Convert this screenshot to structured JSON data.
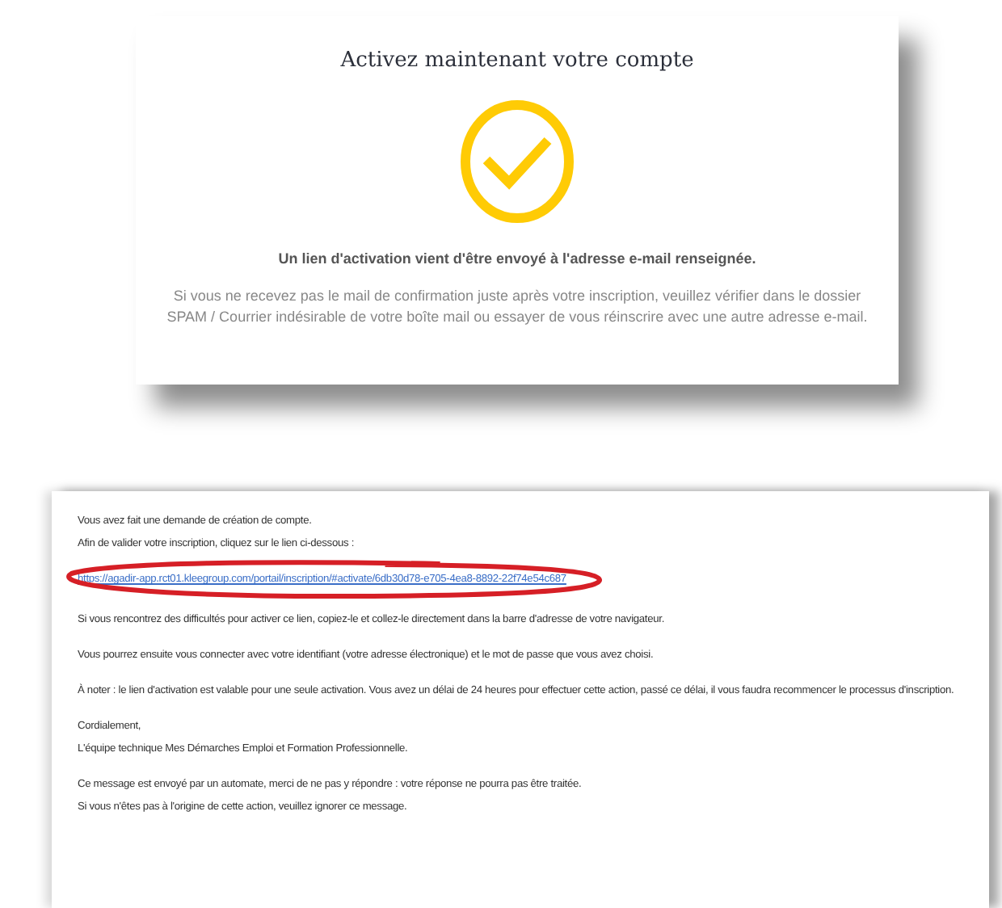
{
  "card": {
    "title": "Activez maintenant votre compte",
    "message": "Un lien d'activation vient d'être envoyé à l'adresse e-mail renseignée.",
    "note": "Si vous ne recevez pas le mail de confirmation juste après votre inscription, veuillez vérifier dans le dossier SPAM / Courrier indésirable de votre boîte mail ou essayer de vous réinscrire avec une autre adresse e-mail."
  },
  "email": {
    "blocks": [
      {
        "kind": "lines",
        "lines": [
          "Vous avez fait une demande de création de compte.",
          "Afin de valider votre inscription, cliquez sur le lien ci-dessous :"
        ]
      },
      {
        "kind": "link",
        "text": "https://agadir-app.rct01.kleegroup.com/portail/inscription/#activate/6db30d78-e705-4ea8-8892-22f74e54c687"
      },
      {
        "kind": "lines",
        "lines": [
          "Si vous rencontrez des difficultés pour activer ce lien, copiez-le et collez-le directement dans la barre d'adresse de votre navigateur."
        ]
      },
      {
        "kind": "lines",
        "lines": [
          "Vous pourrez ensuite vous connecter avec votre identifiant (votre adresse électronique) et le mot de passe que vous avez choisi."
        ]
      },
      {
        "kind": "lines",
        "lines": [
          "À noter : le lien d'activation est valable pour une seule activation. Vous avez un délai de 24 heures pour effectuer cette action, passé ce délai, il vous faudra recommencer le processus d'inscription."
        ]
      },
      {
        "kind": "lines",
        "lines": [
          "Cordialement,",
          "L'équipe technique Mes Démarches Emploi et Formation Professionnelle."
        ]
      },
      {
        "kind": "lines",
        "lines": [
          "Ce message est envoyé par un automate, merci de ne pas y répondre : votre réponse ne pourra pas être traitée.",
          "Si vous n'êtes pas à l'origine de cette action, veuillez ignorer ce message."
        ]
      }
    ]
  }
}
